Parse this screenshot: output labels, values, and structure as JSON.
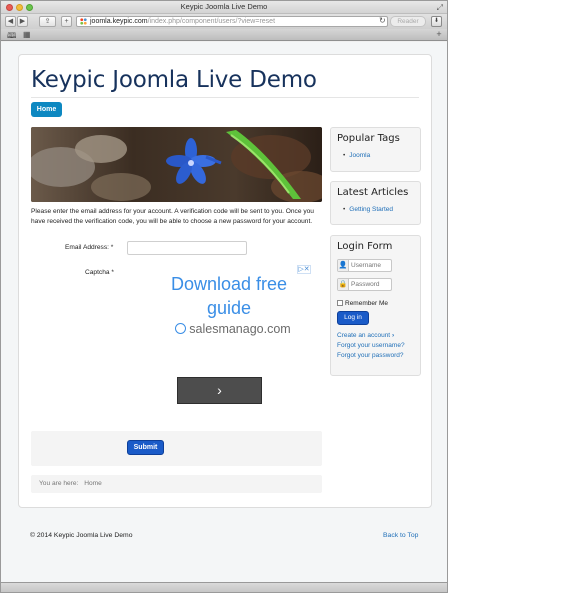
{
  "browser": {
    "window_title": "Keypic Joomla Live Demo",
    "url_host": "joomla.keypic.com",
    "url_path": "/index.php/component/users/?view=reset",
    "reader_label": "Reader"
  },
  "site": {
    "title": "Keypic Joomla Live Demo",
    "nav_home": "Home"
  },
  "reset_form": {
    "intro": "Please enter the email address for your account. A verification code will be sent to you. Once you have received the verification code, you will be able to choose a new password for your account.",
    "email_label": "Email Address: *",
    "email_value": "",
    "captcha_label": "Captcha *",
    "submit_label": "Submit"
  },
  "ad": {
    "headline": "Download free guide",
    "domain": "salesmanago.com"
  },
  "breadcrumb": {
    "prefix": "You are here:",
    "current": "Home"
  },
  "sidebar": {
    "popular_tags": {
      "title": "Popular Tags",
      "items": [
        "Joomla"
      ]
    },
    "latest_articles": {
      "title": "Latest Articles",
      "items": [
        "Getting Started"
      ]
    },
    "login": {
      "title": "Login Form",
      "username_placeholder": "Username",
      "password_placeholder": "Password",
      "remember_label": "Remember Me",
      "login_button": "Log in",
      "create_account": "Create an account",
      "forgot_username": "Forgot your username?",
      "forgot_password": "Forgot your password?"
    }
  },
  "footer": {
    "copyright": "© 2014 Keypic Joomla Live Demo",
    "back_to_top": "Back to Top"
  },
  "colors": {
    "brand_title": "#17325c",
    "accent_blue": "#0d88c1",
    "button_blue": "#1a5bc8",
    "link_blue": "#1f6fb8"
  }
}
